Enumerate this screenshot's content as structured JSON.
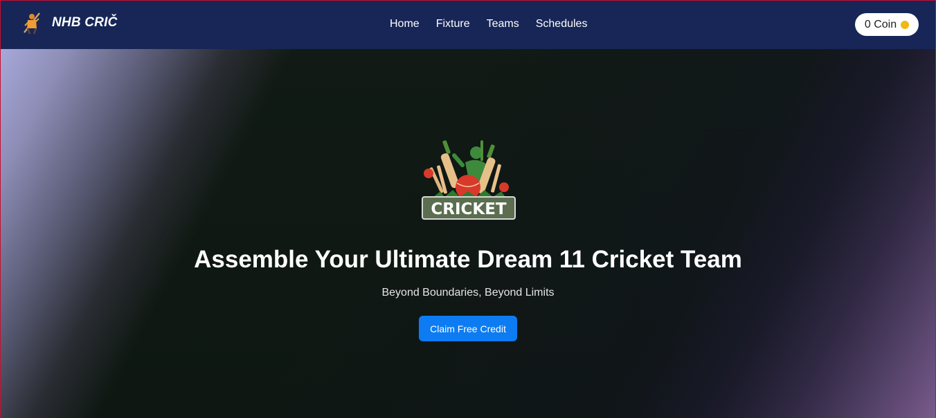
{
  "brand": {
    "name": "NHB CRIČ",
    "logo_icon": "cricket-player-logo-icon"
  },
  "nav": {
    "links": [
      {
        "label": "Home"
      },
      {
        "label": "Fixture"
      },
      {
        "label": "Teams"
      },
      {
        "label": "Schedules"
      }
    ]
  },
  "wallet": {
    "label": "0 Coin",
    "coin_icon": "coin-icon",
    "coin_color": "#f0b913"
  },
  "hero": {
    "logo_text": "CRICKET",
    "logo_icon": "cricket-emblem-icon",
    "title": "Assemble Your Ultimate Dream 11 Cricket Team",
    "subtitle": "Beyond Boundaries, Beyond Limits",
    "cta_label": "Claim Free Credit"
  },
  "colors": {
    "navbar_bg": "#172656",
    "cta_bg": "#0d7cf2",
    "hero_bg": "#0f1512"
  }
}
